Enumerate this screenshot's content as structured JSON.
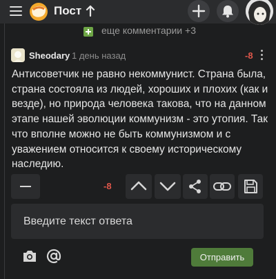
{
  "header": {
    "title": "Пост",
    "icons": [
      "menu-icon",
      "logo-icon",
      "arrow-up-icon",
      "plus-icon",
      "bell-icon",
      "avatar"
    ]
  },
  "more_comments": {
    "text": "еще комментарии +3"
  },
  "comment": {
    "username": "Sheodary",
    "time": "1 день назад",
    "rating": "-8",
    "body": "Антисоветчик не равно некоммунист. Страна была, страна состояла из людей, хороших и плохих (как и везде), но природа человека такова, что на данном этапе нашей эволюции коммунизм - это утопия. Так что вполне можно не быть коммунизмом и с уважением относится к своему историческому наследию."
  },
  "actions": {
    "rating": "-8",
    "icons": [
      "minus-icon",
      "thumb-up-icon",
      "thumb-down-icon",
      "share-icon",
      "link-icon",
      "save-icon"
    ]
  },
  "reply": {
    "placeholder": "Введите текст ответа",
    "send_label": "Отправить"
  },
  "colors": {
    "background": "#1d1e1f",
    "panel": "#2b2c2e",
    "negative": "#e0574b",
    "accent_green": "#4f7b3a"
  }
}
